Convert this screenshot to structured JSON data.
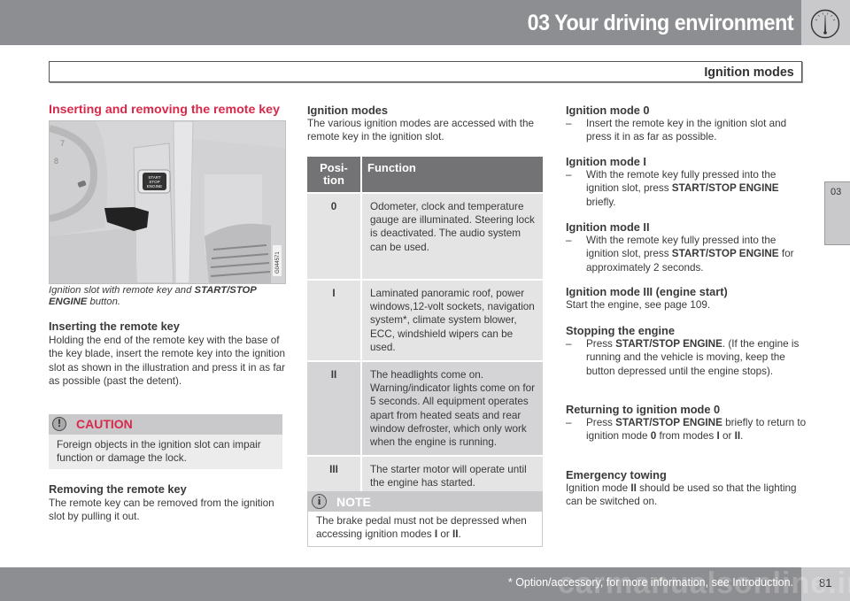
{
  "header": {
    "chapter_title": "03 Your driving environment",
    "chapter_icon": "gauge-icon",
    "section_title": "Ignition modes"
  },
  "side_tab": {
    "label": "03"
  },
  "column1": {
    "heading": "Inserting and removing the remote key",
    "illustration": {
      "button_text": "START STOP ENGINE",
      "dial_numbers": [
        "7",
        "8"
      ],
      "figure_id": "G044571"
    },
    "caption_pre": "Ignition slot with remote key and ",
    "caption_bold1": "START/STOP",
    "caption_bold2": "ENGINE",
    "caption_post": " button.",
    "inserting": {
      "title": "Inserting the remote key",
      "text": "Holding the end of the remote key with the base of the key blade, insert the remote key into the ignition slot as shown in the illustration and press it in as far as possible (past the detent)."
    },
    "caution": {
      "icon": "exclamation-icon",
      "label": "CAUTION",
      "text": "Foreign objects in the ignition slot can impair function or damage the lock."
    },
    "removing": {
      "title": "Removing the remote key",
      "text": "The remote key can be removed from the ignition slot by pulling it out."
    }
  },
  "column2": {
    "title": "Ignition modes",
    "intro": "The various ignition modes are accessed with the remote key in the ignition slot.",
    "table": {
      "headers": [
        "Posi-\ntion",
        "Function"
      ],
      "rows": [
        {
          "position": "0",
          "function": "Odometer, clock and temperature gauge are illuminated. Steering lock is deactivated. The audio system can be used."
        },
        {
          "position": "I",
          "function": "Laminated panoramic roof, power windows,12-volt sockets, navigation system*, climate system blower, ECC, windshield wipers can be used."
        },
        {
          "position": "II",
          "function": "The headlights come on. Warning/indicator lights come on for 5 seconds. All equipment operates apart from heated seats and rear window defroster, which only work when the engine is running."
        },
        {
          "position": "III",
          "function": "The starter motor will operate until the engine has started."
        }
      ]
    },
    "note": {
      "icon": "info-icon",
      "label": "NOTE",
      "text_pre": "The brake pedal must not be depressed when accessing ignition modes ",
      "bold1": "I",
      "mid": " or ",
      "bold2": "II",
      "text_post": "."
    }
  },
  "column3": {
    "dash": "–",
    "mode0": {
      "title": "Ignition mode 0",
      "text": "Insert the remote key in the ignition slot and press it in as far as possible."
    },
    "mode1": {
      "title": "Ignition mode I",
      "pre": "With the remote key fully pressed into the ignition slot, press ",
      "bold": "START/STOP ENGINE",
      "post": " briefly."
    },
    "mode2": {
      "title": "Ignition mode II",
      "pre": "With the remote key fully pressed into the ignition slot, press ",
      "bold": "START/STOP ENGINE",
      "post": " for approximately 2 seconds."
    },
    "mode3": {
      "title": "Ignition mode III (engine start)",
      "text": "Start the engine, see page 109."
    },
    "stopping": {
      "title": "Stopping the engine",
      "pre": "Press ",
      "bold": "START/STOP ENGINE",
      "post": ". (If the engine is running and the vehicle is moving, keep the button depressed until the engine stops)."
    },
    "returning": {
      "title": "Returning to ignition mode 0",
      "pre": "Press ",
      "bold": "START/STOP ENGINE",
      "mid1": " briefly to return to ignition mode ",
      "bold2": "0",
      "mid2": " from modes ",
      "bold3": "I",
      "mid3": " or ",
      "bold4": "II",
      "post": "."
    },
    "towing": {
      "title": "Emergency towing",
      "pre": "Ignition mode ",
      "bold": "II",
      "post": " should be used so that the lighting can be switched on."
    }
  },
  "footer": {
    "footnote": "* Option/accessory, for more information, see Introduction.",
    "page_number": "81",
    "watermark": "carmanualsonline.info"
  }
}
